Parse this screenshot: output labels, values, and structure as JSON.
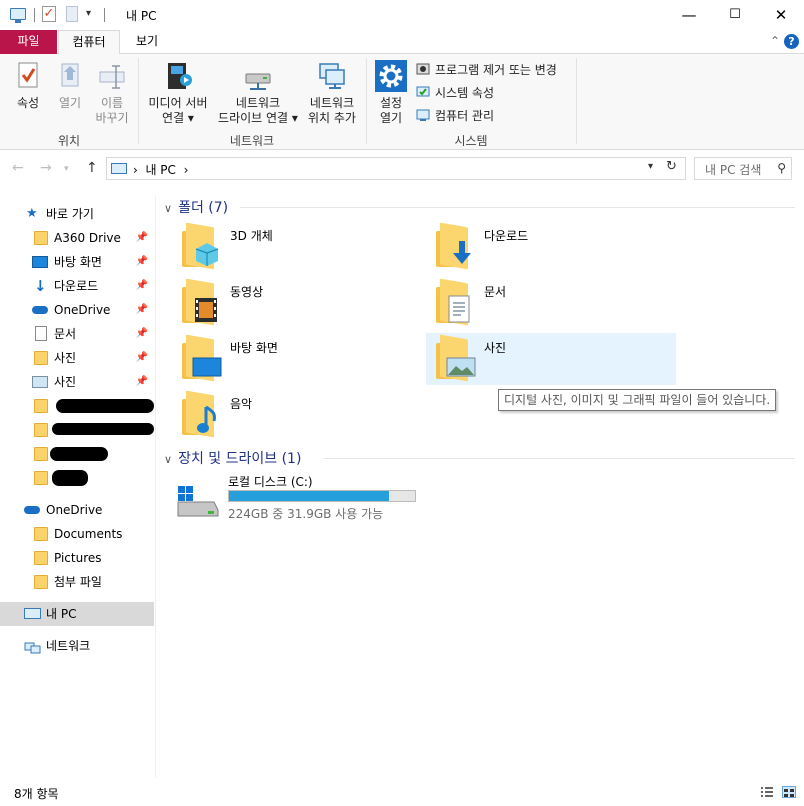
{
  "window": {
    "title": "내 PC",
    "minimize": "—",
    "maximize": "☐",
    "close": "✕"
  },
  "ribbon_tabs": {
    "file": "파일",
    "computer": "컴퓨터",
    "view": "보기"
  },
  "ribbon": {
    "location": {
      "label": "위치",
      "properties": "속성",
      "open": "열기",
      "rename": "이름\n바꾸기"
    },
    "network": {
      "label": "네트워크",
      "media_server": "미디어 서버\n연결 ▾",
      "map_drive": "네트워크\n드라이브 연결 ▾",
      "add_location": "네트워크\n위치 추가"
    },
    "system": {
      "label": "시스템",
      "open_settings": "설정\n열기",
      "uninstall": "프로그램 제거 또는 변경",
      "system_properties": "시스템 속성",
      "manage": "컴퓨터 관리"
    }
  },
  "address": {
    "path_sep": "›",
    "path": "내 PC",
    "path_after": "›",
    "search_placeholder": "내 PC 검색"
  },
  "nav": {
    "quick_access": "바로 가기",
    "items": [
      {
        "label": "A360 Drive",
        "icon": "folder-icon",
        "pinned": true
      },
      {
        "label": "바탕 화면",
        "icon": "desktop-icon",
        "pinned": true
      },
      {
        "label": "다운로드",
        "icon": "download-icon",
        "pinned": true
      },
      {
        "label": "OneDrive",
        "icon": "onedrive-icon",
        "pinned": true
      },
      {
        "label": "문서",
        "icon": "document-icon",
        "pinned": true
      },
      {
        "label": "사진",
        "icon": "folder-icon",
        "pinned": true
      },
      {
        "label": "사진",
        "icon": "pictures-icon",
        "pinned": true
      }
    ],
    "onedrive": "OneDrive",
    "onedrive_items": [
      "Documents",
      "Pictures",
      "첨부 파일"
    ],
    "this_pc": "내 PC",
    "network": "네트워크",
    "pin_glyph": "📌"
  },
  "content": {
    "folders_header": "폴더 (7)",
    "folders": [
      {
        "name": "3D 개체",
        "emblem": "3d-objects-icon"
      },
      {
        "name": "다운로드",
        "emblem": "download-icon"
      },
      {
        "name": "동영상",
        "emblem": "video-icon"
      },
      {
        "name": "문서",
        "emblem": "document-icon"
      },
      {
        "name": "바탕 화면",
        "emblem": "desktop-icon"
      },
      {
        "name": "사진",
        "emblem": "pictures-icon"
      },
      {
        "name": "음악",
        "emblem": "music-icon"
      }
    ],
    "tooltip": "디지털 사진, 이미지 및 그래픽 파일이 들어 있습니다.",
    "drives_header": "장치 및 드라이브 (1)",
    "drive": {
      "name": "로컬 디스크 (C:)",
      "free_text": "224GB 중 31.9GB 사용 가능",
      "used_fraction": 0.86
    }
  },
  "status": {
    "items": "8개 항목"
  },
  "colors": {
    "file_tab": "#b9154a",
    "accent": "#26a0da",
    "header_text": "#1e3287",
    "selected": "#d9d9d9",
    "hover": "#e5f3ff"
  }
}
